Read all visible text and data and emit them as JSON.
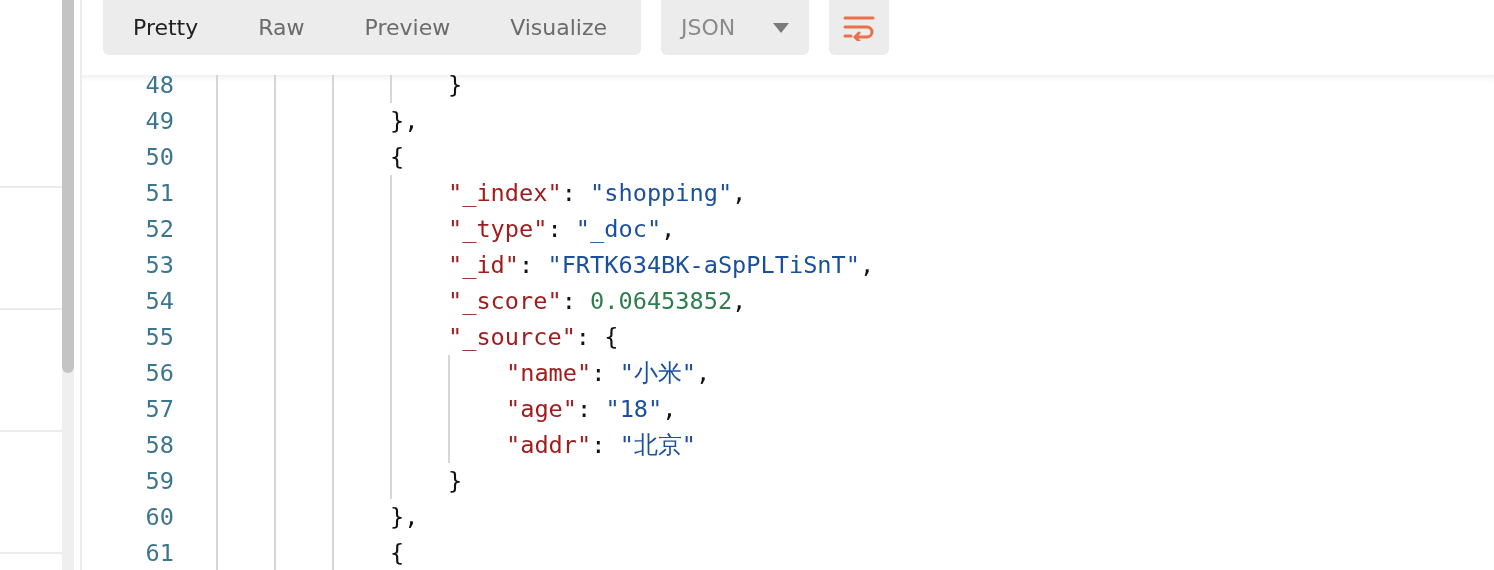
{
  "toolbar": {
    "tabs": [
      {
        "label": "Pretty",
        "selected": true
      },
      {
        "label": "Raw",
        "selected": false
      },
      {
        "label": "Preview",
        "selected": false
      },
      {
        "label": "Visualize",
        "selected": false
      }
    ],
    "format": {
      "label": "JSON"
    },
    "wrap": {
      "on": true
    }
  },
  "code": {
    "lines": [
      {
        "children": [
          {
            "number": "48",
            "tokens": [
              {
                "kind": "punct",
                "text": "}"
              }
            ]
          }
        ]
      },
      {
        "number": "49",
        "tokens": [
          {
            "kind": "punct",
            "text": "},"
          }
        ]
      },
      {
        "number": "50",
        "tokens": [
          {
            "kind": "punct",
            "text": "{"
          }
        ],
        "children": [
          {
            "number": "51",
            "tokens": [
              {
                "kind": "key",
                "text": "\"_index\""
              },
              {
                "kind": "punct",
                "text": ": "
              },
              {
                "kind": "string",
                "text": "\"shopping\""
              },
              {
                "kind": "punct",
                "text": ","
              }
            ]
          },
          {
            "number": "52",
            "tokens": [
              {
                "kind": "key",
                "text": "\"_type\""
              },
              {
                "kind": "punct",
                "text": ": "
              },
              {
                "kind": "string",
                "text": "\"_doc\""
              },
              {
                "kind": "punct",
                "text": ","
              }
            ]
          },
          {
            "number": "53",
            "tokens": [
              {
                "kind": "key",
                "text": "\"_id\""
              },
              {
                "kind": "punct",
                "text": ": "
              },
              {
                "kind": "string",
                "text": "\"FRTK634BK-aSpPLTiSnT\""
              },
              {
                "kind": "punct",
                "text": ","
              }
            ]
          },
          {
            "number": "54",
            "tokens": [
              {
                "kind": "key",
                "text": "\"_score\""
              },
              {
                "kind": "punct",
                "text": ": "
              },
              {
                "kind": "number",
                "text": "0.06453852"
              },
              {
                "kind": "punct",
                "text": ","
              }
            ]
          },
          {
            "number": "55",
            "tokens": [
              {
                "kind": "key",
                "text": "\"_source\""
              },
              {
                "kind": "punct",
                "text": ": {"
              }
            ],
            "children": [
              {
                "number": "56",
                "tokens": [
                  {
                    "kind": "key",
                    "text": "\"name\""
                  },
                  {
                    "kind": "punct",
                    "text": ": "
                  },
                  {
                    "kind": "string",
                    "text": "\"小米\""
                  },
                  {
                    "kind": "punct",
                    "text": ","
                  }
                ]
              },
              {
                "number": "57",
                "tokens": [
                  {
                    "kind": "key",
                    "text": "\"age\""
                  },
                  {
                    "kind": "punct",
                    "text": ": "
                  },
                  {
                    "kind": "string",
                    "text": "\"18\""
                  },
                  {
                    "kind": "punct",
                    "text": ","
                  }
                ]
              },
              {
                "number": "58",
                "tokens": [
                  {
                    "kind": "key",
                    "text": "\"addr\""
                  },
                  {
                    "kind": "punct",
                    "text": ": "
                  },
                  {
                    "kind": "string",
                    "text": "\"北京\""
                  }
                ]
              }
            ]
          },
          {
            "number": "59",
            "tokens": [
              {
                "kind": "punct",
                "text": "}"
              }
            ]
          }
        ]
      },
      {
        "number": "60",
        "tokens": [
          {
            "kind": "punct",
            "text": "},"
          }
        ]
      },
      {
        "number": "61",
        "tokens": [
          {
            "kind": "punct",
            "text": "{"
          }
        ]
      }
    ]
  }
}
